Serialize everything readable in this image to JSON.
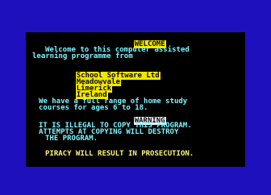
{
  "screen": {
    "heading_welcome": "WELCOME",
    "intro_line1": "Welcome to this computer assisted",
    "intro_line2": "learning programme from",
    "company": [
      "School Software Ltd",
      "Meadowvale",
      "Limerick",
      "Ireland"
    ],
    "range_line1": "We have a full range of home study",
    "range_line2": "courses for ages 6 to 18.",
    "heading_warning": "WARNING",
    "warning_line1": "IT IS ILLEGAL TO COPY THIS PROGRAM.",
    "warning_line2": "ATTEMPTS AT COPYING WILL DESTROY",
    "warning_line3": "THE PROGRAM.",
    "piracy_line": "PIRACY WILL RESULT IN PROSECUTION."
  },
  "colors": {
    "border": "#1e10bd",
    "paper": "#000000",
    "text_white": "#e8e8e8",
    "text_cyan": "#7ff4ff",
    "text_yellow": "#fff67a",
    "highlight_yellow": "#f3e600",
    "highlight_white": "#f5f5f5"
  }
}
